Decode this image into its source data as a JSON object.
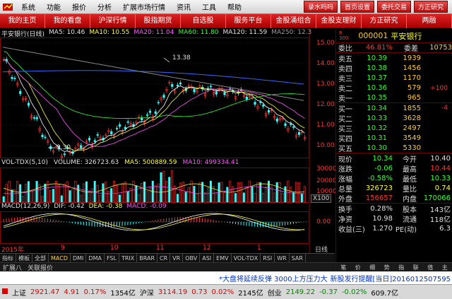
{
  "menu": {
    "items": [
      "系统",
      "功能",
      "报价",
      "分析",
      "扩展市场行情",
      "资讯",
      "工具",
      "帮助"
    ],
    "right_buttons": [
      "录水吗吗",
      "首页设置",
      "委托交易",
      "方正研究"
    ]
  },
  "tabs": [
    "我的主页",
    "我的看盘",
    "沪深行情",
    "股指期货",
    "自选股",
    "服务平台",
    "金股涌组合",
    "金股支理财",
    "方正研究",
    "两融"
  ],
  "chart_info": {
    "name": "平安银行(日线)",
    "ma5": "MA5: 10.46",
    "ma10": "MA10: 10.55",
    "ma20": "MA20: 11.04",
    "ma60": "MA60: 11.80",
    "ma120": "MA120: 11.59",
    "ma250": "MA250: 12.3"
  },
  "price_axis": [
    "15.00",
    "14.00",
    "13.00",
    "12.00",
    "11.00",
    "10.00"
  ],
  "annotations": {
    "high": "13.38",
    "low": "9.30"
  },
  "vol_info": {
    "label": "VOL-TDX(5,10)",
    "volume": "VOLUME: 326723.63",
    "ma5": "MA5: 500889.59",
    "ma10": "MA10: 499334.41"
  },
  "vol_axis": [
    "30000",
    "20000",
    "10000"
  ],
  "vol_unit": "X100",
  "macd_info": {
    "label": "MACD(12,26,9)",
    "dif": "DIF: -0.42",
    "dea": "DEA: -0.38",
    "macd": "MACD: -0.09"
  },
  "macd_axis": [
    "0.00"
  ],
  "date_axis": [
    "2015年",
    "9",
    "10",
    "11",
    "12",
    "1"
  ],
  "period_label": "日线",
  "indicator_tabs": [
    "指标",
    "模板",
    "全部",
    "MACD",
    "DMI",
    "DMA",
    "FSL",
    "TRIX",
    "BRAR",
    "CR",
    "VR",
    "OBV",
    "ASI",
    "EMV",
    "VOL-TDX",
    "RSI",
    "WR",
    "SAR"
  ],
  "bottom_tabs": [
    "扩展八",
    "关联报价"
  ],
  "quote": {
    "code": "000001",
    "name": "平安银行",
    "prefix": "R\n300",
    "weibi_label": "委比",
    "weibi": "46.81%",
    "weicha_label": "委差",
    "weicha": "10753",
    "sell": [
      {
        "label": "卖五",
        "price": "10.39",
        "vol": "1939",
        "delta": ""
      },
      {
        "label": "卖四",
        "price": "10.38",
        "vol": "1456",
        "delta": ""
      },
      {
        "label": "卖三",
        "price": "10.37",
        "vol": "1170",
        "delta": ""
      },
      {
        "label": "卖二",
        "price": "10.36",
        "vol": "579",
        "delta": "+100"
      },
      {
        "label": "卖一",
        "price": "10.35",
        "vol": "965",
        "delta": ""
      }
    ],
    "buy": [
      {
        "label": "买一",
        "price": "10.34",
        "vol": "1855",
        "delta": "-4"
      },
      {
        "label": "买二",
        "price": "10.33",
        "vol": "3628",
        "delta": ""
      },
      {
        "label": "买三",
        "price": "10.32",
        "vol": "2497",
        "delta": ""
      },
      {
        "label": "买四",
        "price": "10.31",
        "vol": "3549",
        "delta": ""
      },
      {
        "label": "买五",
        "price": "10.30",
        "vol": "5330",
        "delta": ""
      }
    ],
    "stats": [
      {
        "l1": "现价",
        "v1": "10.34",
        "l2": "今开",
        "v2": "10.40",
        "c1": "c-g",
        "c2": "c-w"
      },
      {
        "l1": "涨跌",
        "v1": "-0.06",
        "l2": "最高",
        "v2": "10.44",
        "c1": "c-g",
        "c2": "c-r"
      },
      {
        "l1": "涨幅",
        "v1": "-0.58%",
        "l2": "最低",
        "v2": "10.33",
        "c1": "c-g",
        "c2": "c-g"
      },
      {
        "l1": "总量",
        "v1": "326723",
        "l2": "量比",
        "v2": "0.74",
        "c1": "c-y",
        "c2": "c-y"
      },
      {
        "l1": "外盘",
        "v1": "156657",
        "l2": "内盘",
        "v2": "170066",
        "c1": "c-r",
        "c2": "c-g"
      }
    ],
    "stats2": [
      {
        "l1": "换手",
        "v1": "0.28%",
        "l2": "股本",
        "v2": "143亿",
        "c1": "c-w",
        "c2": "c-w"
      },
      {
        "l1": "净资",
        "v1": "10.98",
        "l2": "流通",
        "v2": "118亿",
        "c1": "c-w",
        "c2": "c-w"
      },
      {
        "l1": "收益(三)",
        "v1": "1.270",
        "l2": "PE(动)",
        "v2": "6.3",
        "c1": "c-w",
        "c2": "c-w"
      }
    ],
    "tabs": [
      "笔",
      "价",
      "细",
      "势",
      "指",
      "联",
      "值",
      "主"
    ]
  },
  "news": {
    "left": "*大盘将延续反弹 3000上方压力大",
    "right": "新股发行提醒[当日]2016012507595"
  },
  "status": {
    "sh_label": "上证",
    "sh_val": "2921.47",
    "sh_chg": "4.91",
    "sh_pct": "0.17%",
    "sh_amt": "1354亿",
    "sz_label": "沪深",
    "sz_val": "3114.19",
    "sz_chg": "0.73",
    "sz_pct": "0.02%",
    "sz_amt": "2145亿",
    "cy_label": "创业",
    "cy_val": "2149.22",
    "cy_chg": "-0.37",
    "cy_pct": "-0.02%",
    "cy_amt": "609.7亿"
  },
  "colors": {
    "up": "#ff3333",
    "down": "#33ffff",
    "ma5": "#ffffff",
    "ma10": "#ffff33",
    "ma20": "#ff55ff",
    "ma60": "#33ff33",
    "ma120": "#3366ff",
    "ma250": "#888888"
  }
}
